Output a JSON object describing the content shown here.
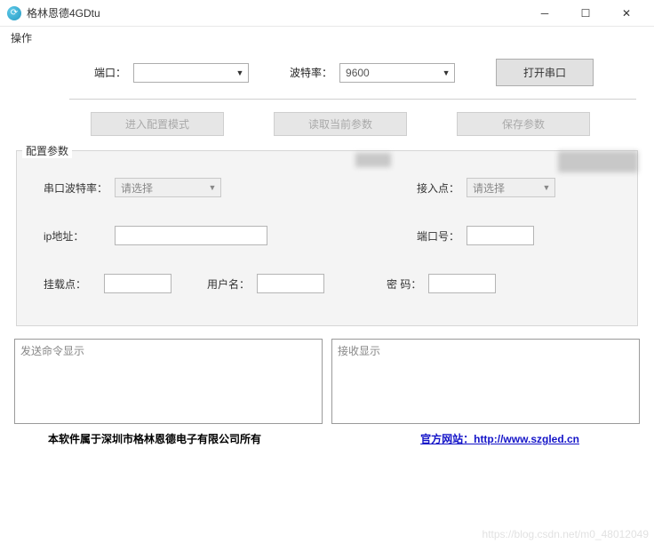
{
  "window": {
    "title": "格林恩德4GDtu"
  },
  "menu": {
    "op": "操作"
  },
  "toolbar": {
    "port_label": "端口：",
    "port_value": "",
    "baud_label": "波特率：",
    "baud_value": "9600",
    "open_label": "打开串口"
  },
  "actions": {
    "enter_cfg": "进入配置模式",
    "read_params": "读取当前参数",
    "save_params": "保存参数"
  },
  "group": {
    "legend": "配置参数",
    "serial_baud_label": "串口波特率：",
    "serial_baud_value": "请选择",
    "apn_label": "接入点：",
    "apn_value": "请选择",
    "ip_label": "ip地址：",
    "ip_value": "",
    "portnum_label": "端口号：",
    "portnum_value": "",
    "mount_label": "挂载点：",
    "mount_value": "",
    "user_label": "用户名：",
    "user_value": "",
    "pwd_label": "密  码：",
    "pwd_value": ""
  },
  "log": {
    "send_placeholder": "发送命令显示",
    "recv_placeholder": "接收显示"
  },
  "footer": {
    "copyright": "本软件属于深圳市格林恩德电子有限公司所有",
    "site_label": "官方网站：http://www.szgled.cn"
  },
  "watermark": "https://blog.csdn.net/m0_48012049"
}
